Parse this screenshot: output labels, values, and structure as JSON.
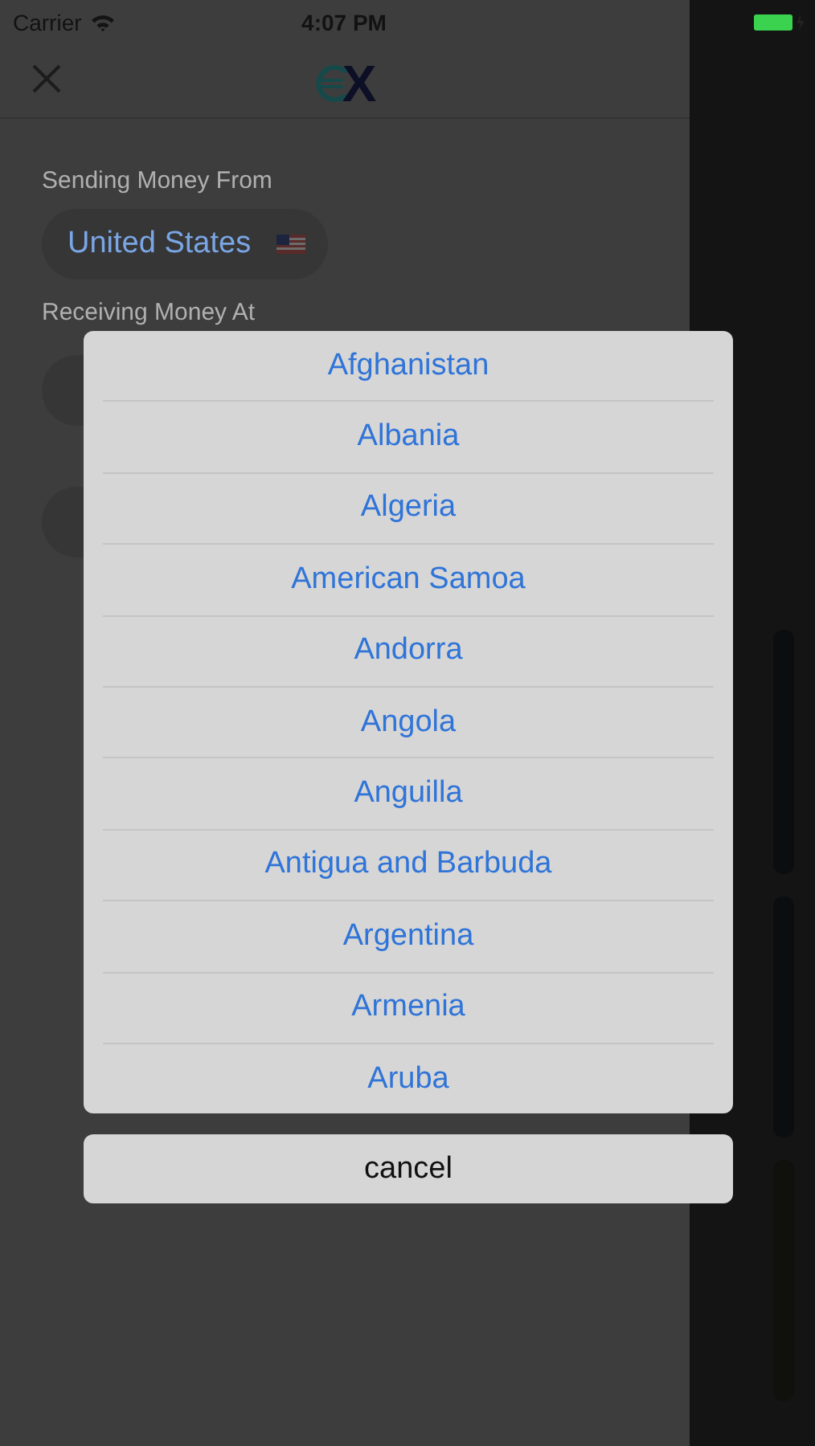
{
  "status_bar": {
    "carrier": "Carrier",
    "time": "4:07 PM"
  },
  "header": {
    "logo_text": "X"
  },
  "form": {
    "sending_label": "Sending Money From",
    "sending_country": "United States",
    "receiving_label": "Receiving Money At"
  },
  "country_sheet": {
    "options": [
      {
        "label": "Afghanistan"
      },
      {
        "label": "Albania"
      },
      {
        "label": "Algeria"
      },
      {
        "label": "American Samoa"
      },
      {
        "label": "Andorra"
      },
      {
        "label": "Angola"
      },
      {
        "label": "Anguilla"
      },
      {
        "label": "Antigua and Barbuda"
      },
      {
        "label": "Argentina"
      },
      {
        "label": "Armenia"
      },
      {
        "label": "Aruba"
      }
    ],
    "cancel": "cancel"
  }
}
